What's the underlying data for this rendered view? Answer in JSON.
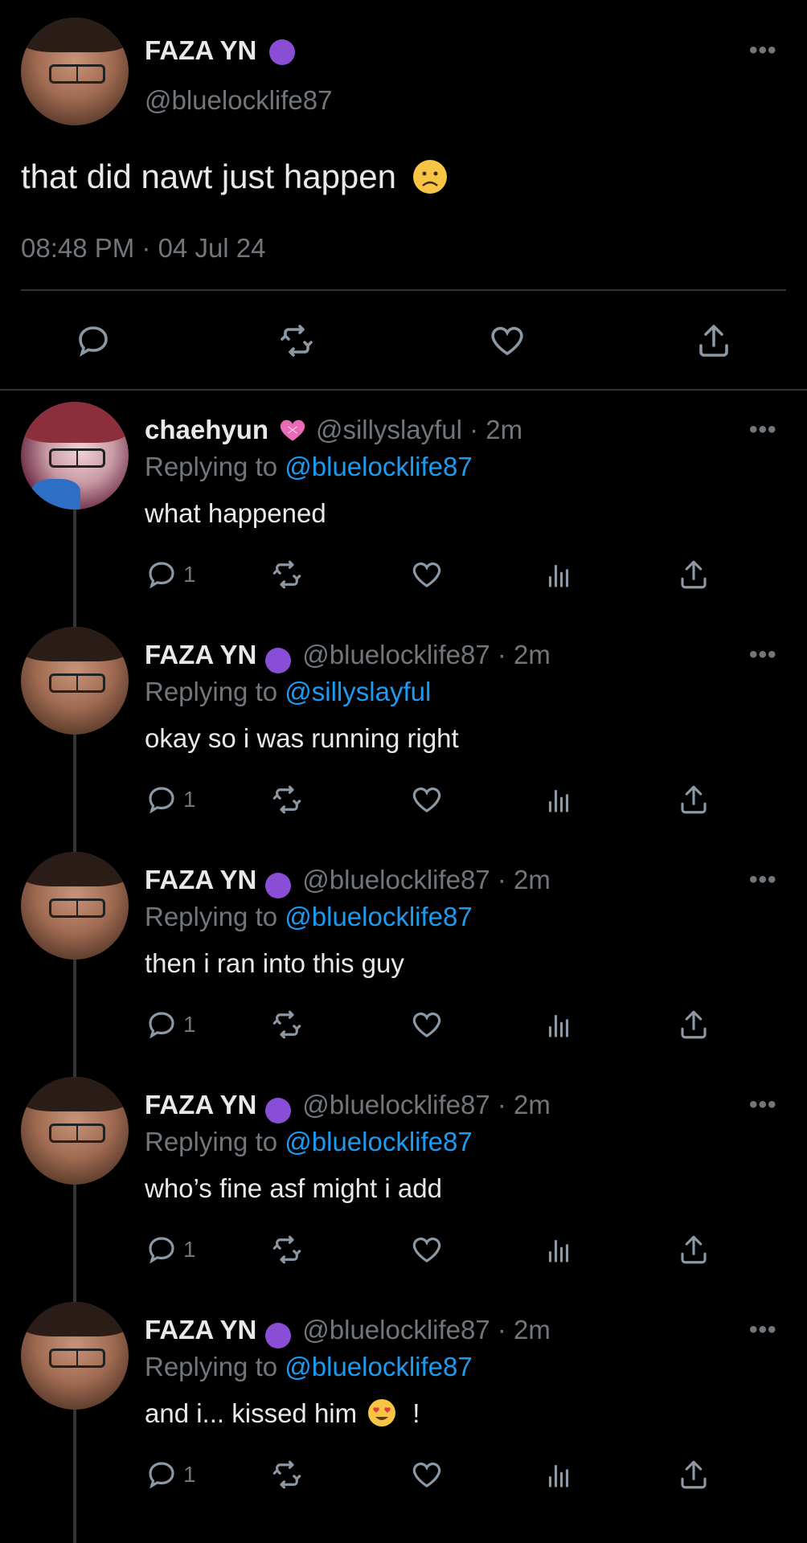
{
  "main_tweet": {
    "author_name": "FAZA YN",
    "author_handle": "@bluelocklife87",
    "text": "that did nawt just happen",
    "timestamp": "08:48 PM · 04 Jul 24"
  },
  "replies": [
    {
      "name": "chaehyun",
      "handle": "@sillyslayful · 2m",
      "replying_prefix": "Replying to ",
      "replying_to": "@bluelocklife87",
      "text": "what happened",
      "reply_count": "1"
    },
    {
      "name": "FAZA YN",
      "handle": "@bluelocklife87 · 2m",
      "replying_prefix": "Replying to ",
      "replying_to": "@sillyslayful",
      "text": "okay so i was running right",
      "reply_count": "1"
    },
    {
      "name": "FAZA YN",
      "handle": "@bluelocklife87 · 2m",
      "replying_prefix": "Replying to ",
      "replying_to": "@bluelocklife87",
      "text": "then i ran into this guy",
      "reply_count": "1"
    },
    {
      "name": "FAZA YN",
      "handle": "@bluelocklife87 · 2m",
      "replying_prefix": "Replying to ",
      "replying_to": "@bluelocklife87",
      "text": "who’s fine asf might i add",
      "reply_count": "1"
    },
    {
      "name": "FAZA YN",
      "handle": "@bluelocklife87 · 2m",
      "replying_prefix": "Replying to ",
      "replying_to": "@bluelocklife87",
      "text": "and i... kissed him",
      "text_suffix": "!",
      "reply_count": "1"
    }
  ],
  "more_label": "•••",
  "colors": {
    "background": "#000000",
    "text": "#e7e9ea",
    "muted": "#71767b",
    "link": "#1d9bf0",
    "divider": "#2f3336"
  }
}
